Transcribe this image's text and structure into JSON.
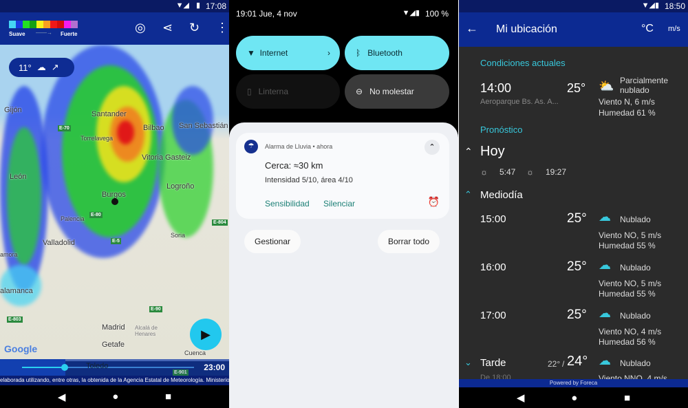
{
  "radar_app": {
    "status": {
      "time": "17:08"
    },
    "legend": {
      "low": "Suave",
      "high": "Fuerte",
      "colors": [
        "#45d4f4",
        "#1a3ae0",
        "#22e022",
        "#14a014",
        "#f4f41c",
        "#f8a020",
        "#f01818",
        "#d40c0c",
        "#f41cf0",
        "#b070d0"
      ]
    },
    "toolbar": {
      "icons": [
        "locate-icon",
        "share-icon",
        "history-icon",
        "more-icon"
      ]
    },
    "weather_chip": {
      "temp": "11°",
      "icon": "cloud-icon",
      "wind": "↗"
    },
    "cities": [
      "Gijón",
      "Santander",
      "Bilbao",
      "San Sebastián",
      "Torrelavega",
      "Vitoria Gasteiz",
      "León",
      "Logroño",
      "Burgos",
      "Palencia",
      "Valladolid",
      "Soria",
      "amora",
      "alamanca",
      "Madrid",
      "Alcalá de Henares",
      "Getafe",
      "Cuenca",
      "Toledo"
    ],
    "roads": [
      "E-70",
      "E-80",
      "E-5",
      "E-804",
      "E-90",
      "E-803",
      "E-901"
    ],
    "timeline": {
      "time": "23:00",
      "progress": 0.33
    },
    "attribution": "elaborada utilizando, entre otras, la obtenida de la Agencia Estatal de Meteorología. Ministerio",
    "google": "Google"
  },
  "notification_shade": {
    "status": {
      "datetime": "19:01 Jue, 4 nov",
      "battery": "100 %"
    },
    "tiles": [
      {
        "label": "Internet",
        "active": true
      },
      {
        "label": "Bluetooth",
        "active": true
      },
      {
        "label": "Linterna",
        "active": false
      },
      {
        "label": "No molestar",
        "active": false
      }
    ],
    "notification": {
      "app": "Alarma de Lluvia • ahora",
      "title": "Cerca: ≈30 km",
      "text": "Intensidad 5/10, área 4/10",
      "actions": [
        "Sensibilidad",
        "Silenciar"
      ]
    },
    "buttons": {
      "manage": "Gestionar",
      "clear": "Borrar todo"
    }
  },
  "location_app": {
    "status": {
      "time": "18:50"
    },
    "toolbar": {
      "title": "Mi ubicación",
      "unit_temp": "°C",
      "unit_wind": "m/s"
    },
    "current": {
      "heading": "Condiciones actuales",
      "time": "14:00",
      "station": "Aeroparque Bs. As. A...",
      "temp": "25°",
      "condition": "Parcialmente nublado",
      "wind": "Viento N, 6 m/s",
      "humidity": "Humedad 61 %"
    },
    "forecast": {
      "heading": "Pronóstico",
      "day": "Hoy",
      "sunrise": "5:47",
      "sunset": "19:27",
      "period": "Mediodía",
      "hours": [
        {
          "time": "15:00",
          "temp": "25°",
          "condition": "Nublado",
          "wind": "Viento NO, 5 m/s",
          "humidity": "Humedad 55 %"
        },
        {
          "time": "16:00",
          "temp": "25°",
          "condition": "Nublado",
          "wind": "Viento NO, 5 m/s",
          "humidity": "Humedad 55 %"
        },
        {
          "time": "17:00",
          "temp": "25°",
          "condition": "Nublado",
          "wind": "Viento NO, 4 m/s",
          "humidity": "Humedad 56 %"
        }
      ],
      "tarde": {
        "label": "Tarde",
        "low": "22°",
        "high": "24°",
        "condition": "Nublado",
        "sub": "De 18:00",
        "wind": "Viento NNO, 4 m/s"
      }
    },
    "footer": "Powered by Foreca"
  }
}
